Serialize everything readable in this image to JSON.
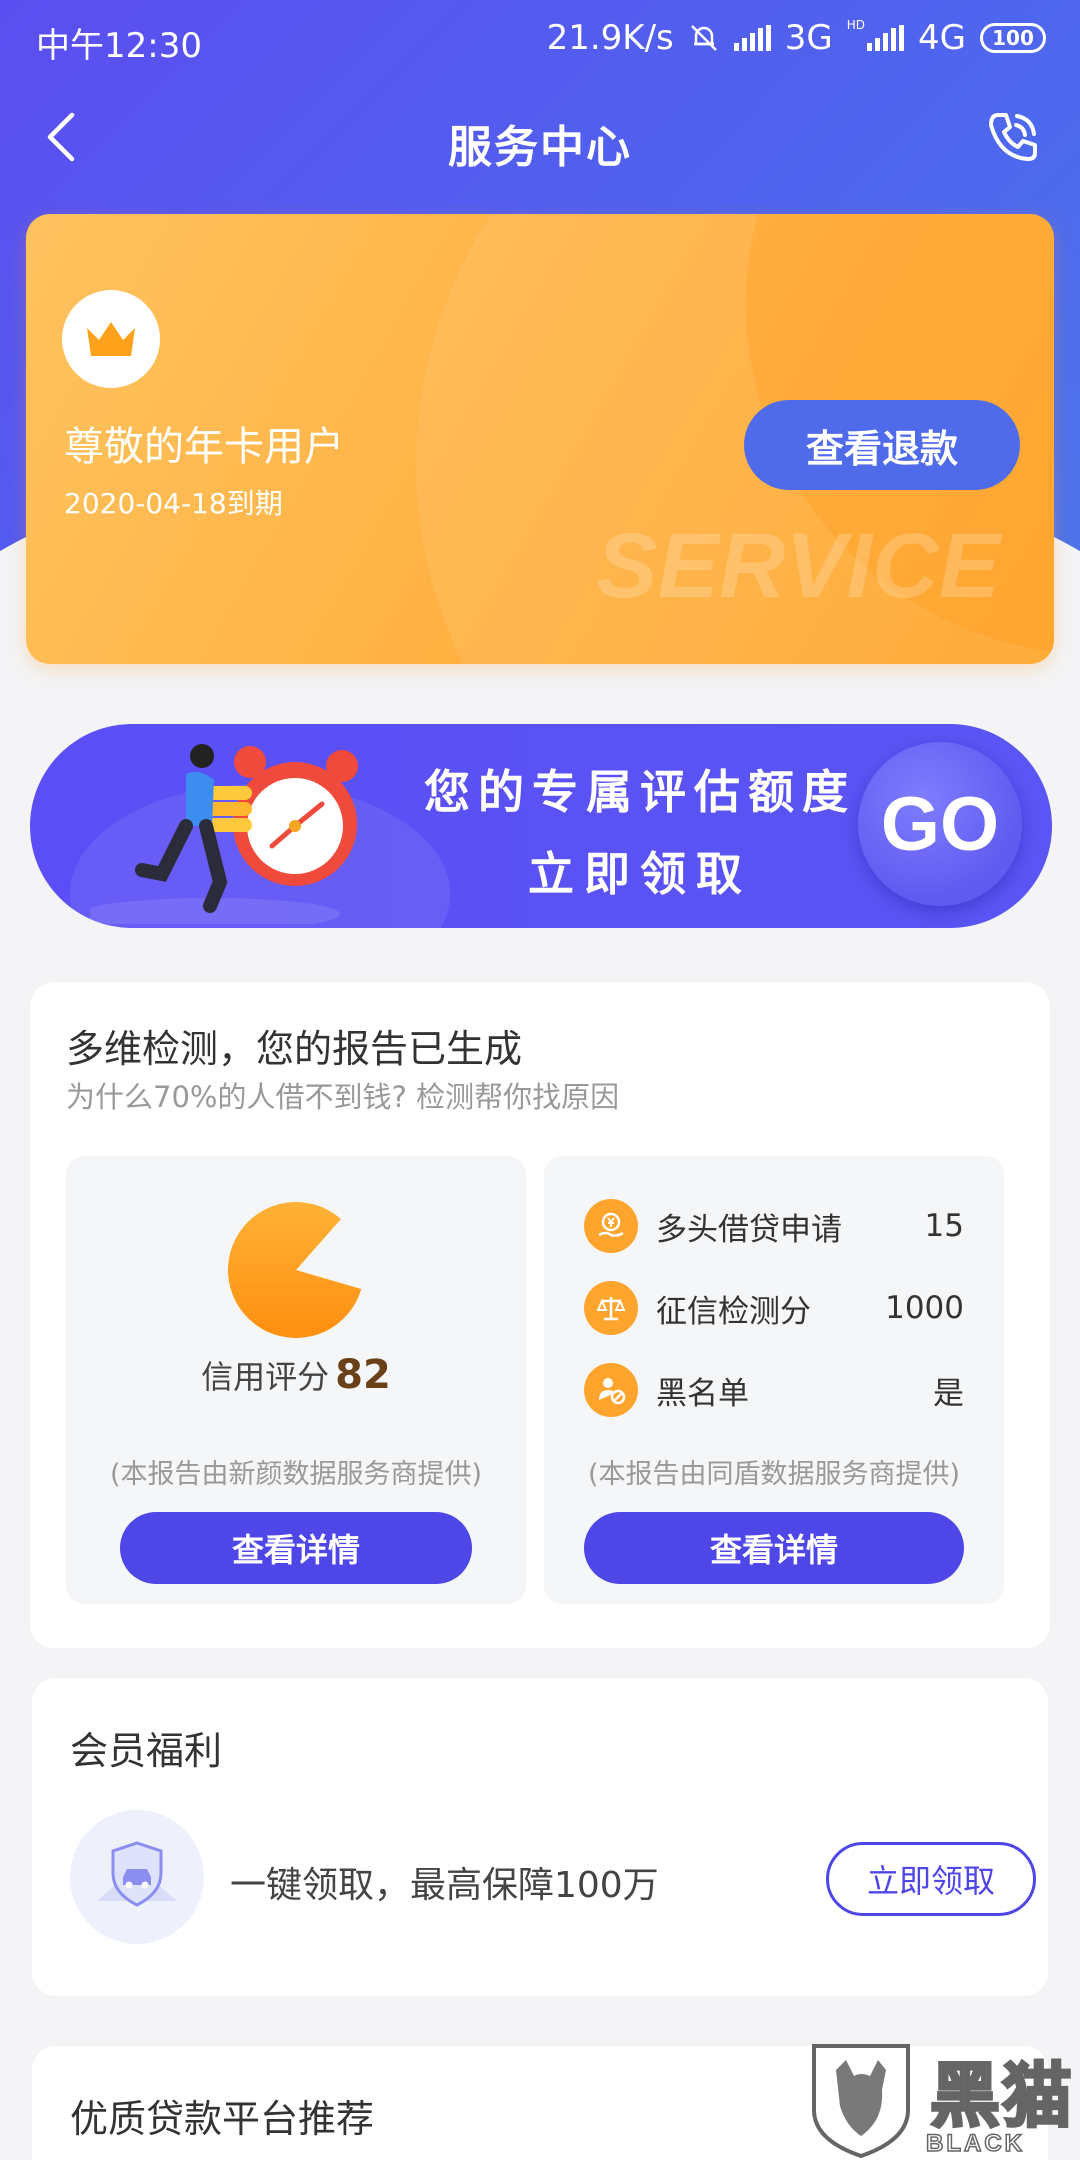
{
  "status_bar": {
    "time": "中午12:30",
    "net_speed": "21.9K/s",
    "net1": "3G",
    "hd": "HD",
    "net2": "4G",
    "battery": "100"
  },
  "nav": {
    "title": "服务中心",
    "back_icon": "chevron-left-icon",
    "phone_icon": "phone-icon"
  },
  "member_card": {
    "title": "尊敬的年卡用户",
    "expire": "2020-04-18到期",
    "refund_button": "查看退款",
    "watermark": "SERVICE",
    "icon": "crown-icon"
  },
  "assess_banner": {
    "line1": "您的专属评估额度",
    "line2": "立即领取",
    "go_button": "GO"
  },
  "report": {
    "title": "多维检测，您的报告已生成",
    "subtitle": "为什么70%的人借不到钱? 检测帮你找原因",
    "left": {
      "credit_label": "信用评分",
      "credit_score": "82",
      "credit_fraction": 0.82,
      "provider": "(本报告由新颜数据服务商提供)",
      "detail_button": "查看详情"
    },
    "right": {
      "items": [
        {
          "label": "多头借贷申请",
          "value": "15",
          "icon": "yen-hand-icon"
        },
        {
          "label": "征信检测分",
          "value": "1000",
          "icon": "scale-icon"
        },
        {
          "label": "黑名单",
          "value": "是",
          "icon": "user-block-icon"
        }
      ],
      "provider": "(本报告由同盾数据服务商提供)",
      "detail_button": "查看详情"
    }
  },
  "benefits": {
    "title": "会员福利",
    "text": "一键领取，最高保障100万",
    "claim_button": "立即领取",
    "icon": "car-shield-icon"
  },
  "platforms": {
    "title": "优质贷款平台推荐"
  },
  "watermark": {
    "cn": "黑猫",
    "en": "BLACK CAT"
  },
  "colors": {
    "primary": "#4f46e8",
    "header": "#5564ef",
    "gold": "#ffb040"
  }
}
